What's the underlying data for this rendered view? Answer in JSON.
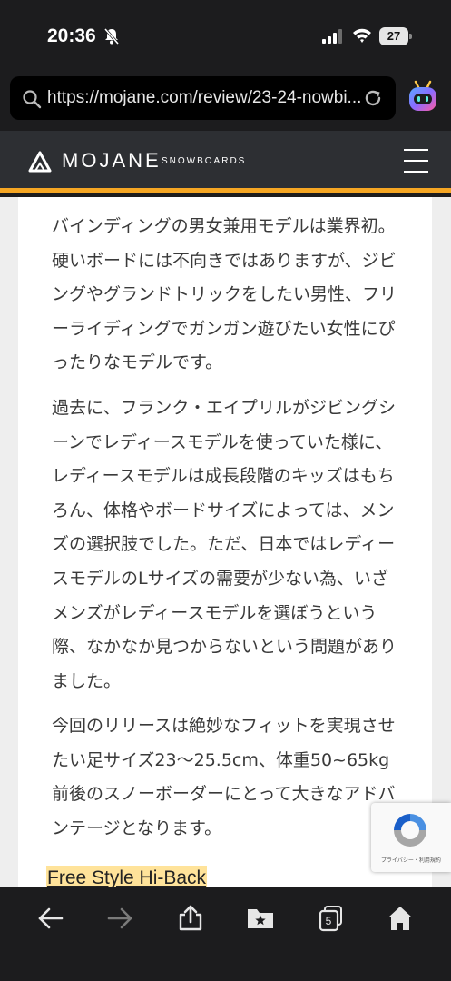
{
  "status": {
    "time": "20:36",
    "battery": "27"
  },
  "browser": {
    "url": "https://mojane.com/review/23-24-nowbi..."
  },
  "site": {
    "logo_text": "MOJANE",
    "logo_sub": "SNOWBOARDS",
    "accent_color": "#f5a623"
  },
  "article": {
    "paragraphs": [
      "バインディングの男女兼用モデルは業界初。硬いボードには不向きではありますが、ジビングやグランドトリックをしたい男性、フリーライディングでガンガン遊びたい女性にぴったりなモデルです。",
      "過去に、フランク・エイプリルがジビングシーンでレディースモデルを使っていた様に、レディースモデルは成長段階のキッズはもちろん、体格やボードサイズによっては、メンズの選択肢でした。ただ、日本ではレディースモデルのLサイズの需要が少ない為、いざメンズがレディースモデルを選ぼうという際、なかなか見つからないという問題がありました。",
      "今回のリリースは絶妙なフィットを実現させたい足サイズ23〜25.5cm、体重50~65kg前後のスノーボーダーにとって大きなアドバンテージとなります。"
    ],
    "section_heading": "Free Style Hi-Back"
  },
  "recaptcha": {
    "text": "プライバシー・利用規約"
  },
  "toolbar": {
    "tabs_count": "5",
    "icons": [
      "back-arrow-icon",
      "forward-arrow-icon",
      "share-icon",
      "bookmark-folder-icon",
      "tabs-icon",
      "home-icon"
    ]
  }
}
